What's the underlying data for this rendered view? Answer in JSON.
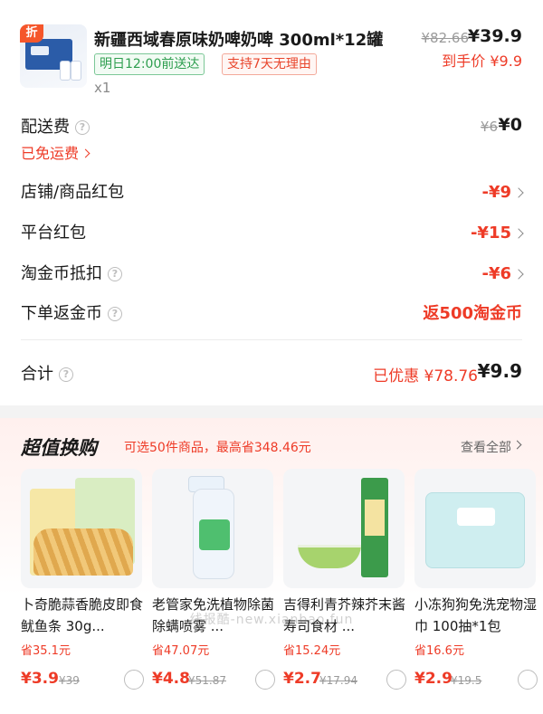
{
  "product": {
    "discount_badge": "折",
    "title": "新疆西域春原味奶啤奶啤 300ml*12罐",
    "tags": [
      "明日12:00前送达",
      "支持7天无理由"
    ],
    "quantity": "x1",
    "original_price": "¥82.66",
    "price": "¥39.9",
    "hand_price": "到手价 ¥9.9"
  },
  "shipping": {
    "label": "配送费",
    "original": "¥6",
    "value": "¥0",
    "free_link": "已免运费"
  },
  "rows": [
    {
      "label": "店铺/商品红包",
      "value": "-¥9"
    },
    {
      "label": "平台红包",
      "value": "-¥15"
    },
    {
      "label": "淘金币抵扣",
      "value": "-¥6"
    },
    {
      "label": "下单返金币",
      "value": "返500淘金币"
    }
  ],
  "total": {
    "label": "合计",
    "saved": "已优惠 ¥78.76",
    "value": "¥9.9"
  },
  "deals": {
    "title": "超值换购",
    "subtitle": "可选50件商品，最高省348.46元",
    "view_all": "查看全部",
    "items": [
      {
        "name": "卜奇脆蒜香脆皮即食鱿鱼条 30g...",
        "save": "省35.1元",
        "price": "¥3.9",
        "orig": "¥39"
      },
      {
        "name": "老管家免洗植物除菌除螨喷雾 ...",
        "save": "省47.07元",
        "price": "¥4.8",
        "orig": "¥51.87"
      },
      {
        "name": "吉得利青芥辣芥末酱寿司食材 ...",
        "save": "省15.24元",
        "price": "¥2.7",
        "orig": "¥17.94"
      },
      {
        "name": "小冻狗狗免洗宠物湿巾 100抽*1包",
        "save": "省16.6元",
        "price": "¥2.9",
        "orig": "¥19.5"
      }
    ]
  },
  "watermark": "线报酷-new.xianbao.fun"
}
